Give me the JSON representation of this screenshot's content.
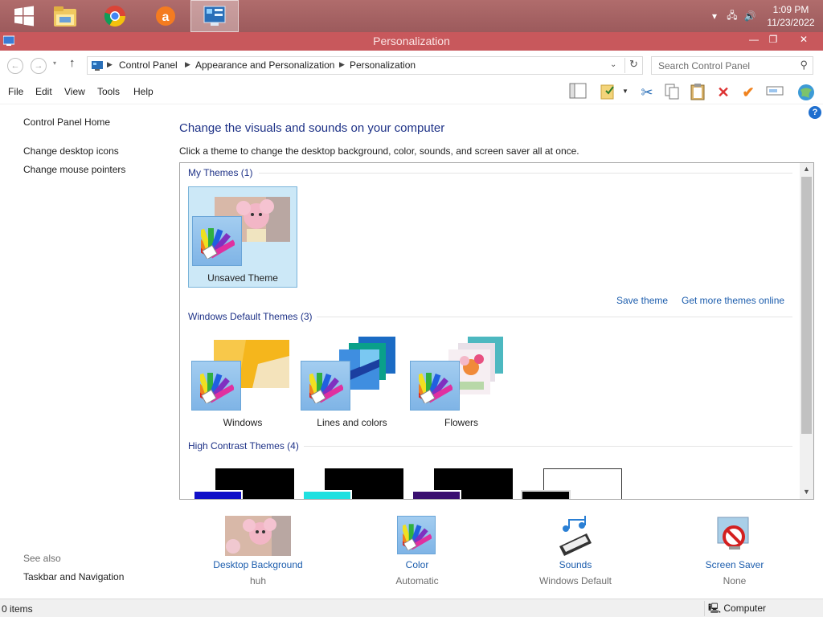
{
  "taskbar": {
    "time": "1:09 PM",
    "date": "11/23/2022",
    "apps": [
      "windows-logo",
      "file-explorer",
      "chrome",
      "avast",
      "control-panel"
    ]
  },
  "window": {
    "title": "Personalization",
    "minimize": "—",
    "maximize": "❐",
    "close": "✕"
  },
  "address": {
    "crumbs": [
      "Control Panel",
      "Appearance and Personalization",
      "Personalization"
    ],
    "search_placeholder": "Search Control Panel"
  },
  "menu": {
    "items": [
      "File",
      "Edit",
      "View",
      "Tools",
      "Help"
    ]
  },
  "leftnav": {
    "home": "Control Panel Home",
    "links": [
      "Change desktop icons",
      "Change mouse pointers"
    ],
    "see_also": "See also",
    "see_also_links": [
      "Taskbar and Navigation"
    ]
  },
  "main": {
    "heading": "Change the visuals and sounds on your computer",
    "subheading": "Click a theme to change the desktop background, color, sounds, and screen saver all at once.",
    "groups": [
      {
        "title": "My Themes (1)",
        "themes": [
          "Unsaved Theme"
        ]
      },
      {
        "title": "Windows Default Themes (3)",
        "themes": [
          "Windows",
          "Lines and colors",
          "Flowers"
        ]
      },
      {
        "title": "High Contrast Themes (4)",
        "themes": []
      }
    ],
    "save_theme": "Save theme",
    "more_themes": "Get more themes online"
  },
  "settings": [
    {
      "label": "Desktop Background",
      "value": "huh"
    },
    {
      "label": "Color",
      "value": "Automatic"
    },
    {
      "label": "Sounds",
      "value": "Windows Default"
    },
    {
      "label": "Screen Saver",
      "value": "None"
    }
  ],
  "status": {
    "items": "0 items",
    "location": "Computer"
  },
  "colors": {
    "taskbar": "#a0605f",
    "titlebar": "#c8585c",
    "link": "#1c5dad",
    "heading": "#1e3287",
    "selection": "#cce8f7"
  }
}
